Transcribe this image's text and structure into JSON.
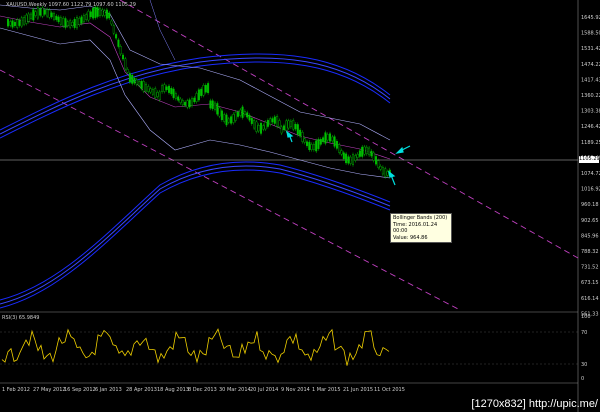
{
  "header": {
    "text": "XAUUSD,Weekly  1097.60 1122.79 1097.60 1105.29"
  },
  "rsi_header": {
    "text": "RSI(3) 65.9849"
  },
  "tooltip": {
    "title": "Bollinger Bands (200)",
    "time": "Time: 2016.01.24 00:00",
    "value": "Value: 964.86"
  },
  "price_label": {
    "text": "1105.29"
  },
  "y_axis_labels": [
    "1645.92",
    "1588.50",
    "1531.42",
    "1474.22",
    "1417.43",
    "1360.22",
    "1303.38",
    "1246.42",
    "1189.25",
    "1132.46",
    "1074.72",
    "1016.92",
    "960.18",
    "902.65",
    "845.96",
    "788.32",
    "731.52",
    "673.15",
    "616.14",
    "561.33"
  ],
  "rsi_axis_labels": [
    "100",
    "70",
    "30",
    "0"
  ],
  "x_axis_labels": [
    "1 Feb 2012",
    "27 May 2012",
    "16 Sep 2012",
    "6 Jan 2013",
    "28 Apr 2013",
    "18 Aug 2013",
    "8 Dec 2013",
    "30 Mar 2014",
    "20 Jul 2014",
    "9 Nov 2014",
    "1 Mar 2015",
    "21 Jun 2015",
    "11 Oct 2015"
  ],
  "watermark": {
    "text": "[1270x832] http://upic.me/"
  },
  "colors": {
    "background": "#000000",
    "candles": "#00c000",
    "bands_blue": "#2a3cff",
    "bands_purple": "#c040c0",
    "channel": "#c040c0",
    "rsi": "#f0d000",
    "arrow": "#00e0e0"
  }
}
